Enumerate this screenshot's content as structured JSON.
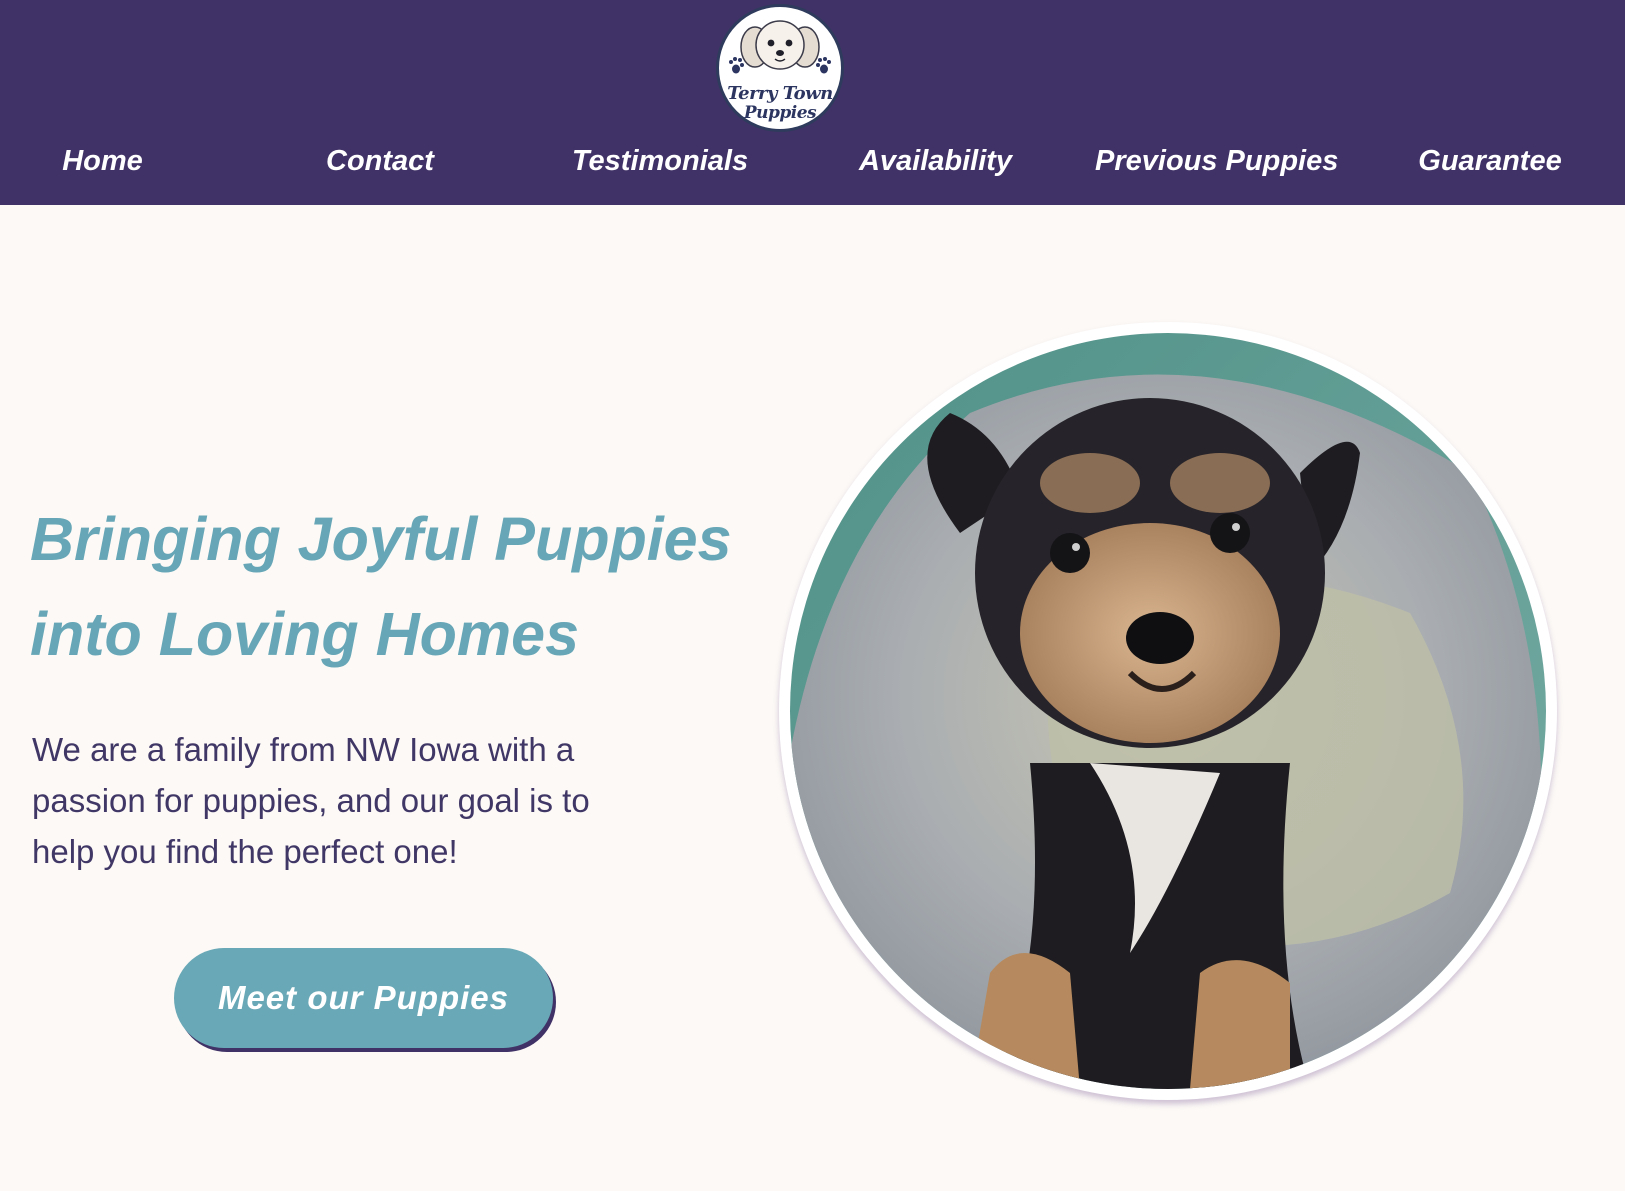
{
  "header": {
    "logo_line1": "Terry Town",
    "logo_line2": "Puppies",
    "nav": {
      "home": "Home",
      "contact": "Contact",
      "testimonials": "Testimonials",
      "availability": "Availability",
      "previous_puppies": "Previous Puppies",
      "guarantee": "Guarantee"
    }
  },
  "hero": {
    "title_line1": "Bringing Joyful Puppies",
    "title_line2": "into Loving Homes",
    "text_line1": "We are a family from NW Iowa with a",
    "text_line2": "passion for puppies, and our goal is to",
    "text_line3": "help you find the perfect one!",
    "cta_label": "Meet our Puppies"
  },
  "colors": {
    "header_bg": "#403266",
    "page_bg": "#fcf9f6",
    "accent": "#66a6b6",
    "body_text": "#413766"
  }
}
